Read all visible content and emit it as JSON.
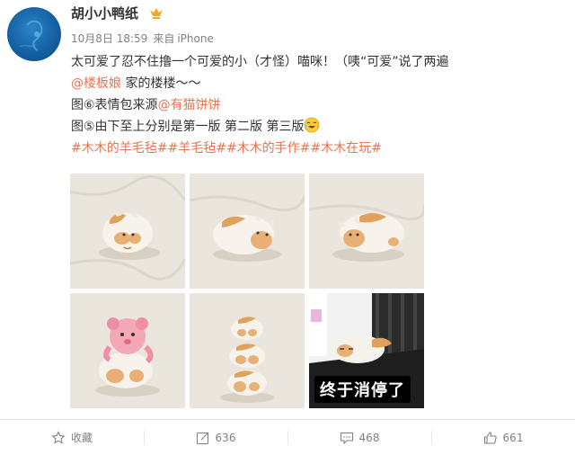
{
  "user": {
    "name": "胡小小鸭纸"
  },
  "meta": {
    "date": "10月8日 18:59",
    "source_prefix": "来自",
    "source": "iPhone"
  },
  "post": {
    "line1": "太可爱了忍不住撸一个可爱的小（才怪）喵咪！（咦“可爱”说了两遍",
    "line2_mention": "@楼板娘",
    "line2_text": " 家的楼楼～～",
    "line3_text": "图⑥表情包来源",
    "line3_mention": "@有猫饼饼",
    "line4_text": "图⑤由下至上分别是第一版 第二版 第三版",
    "topics": [
      "#木木的羊毛毡#",
      "#羊毛毡#",
      "#木木的手作#",
      "#木木在玩#"
    ]
  },
  "photos": {
    "caption6": "终于消停了"
  },
  "actions": {
    "favorite": "收藏",
    "repost": "636",
    "comment": "468",
    "like": "661"
  },
  "colors": {
    "link": "#eb7350",
    "text": "#333333",
    "muted": "#808080",
    "vip": "#f5a623"
  }
}
